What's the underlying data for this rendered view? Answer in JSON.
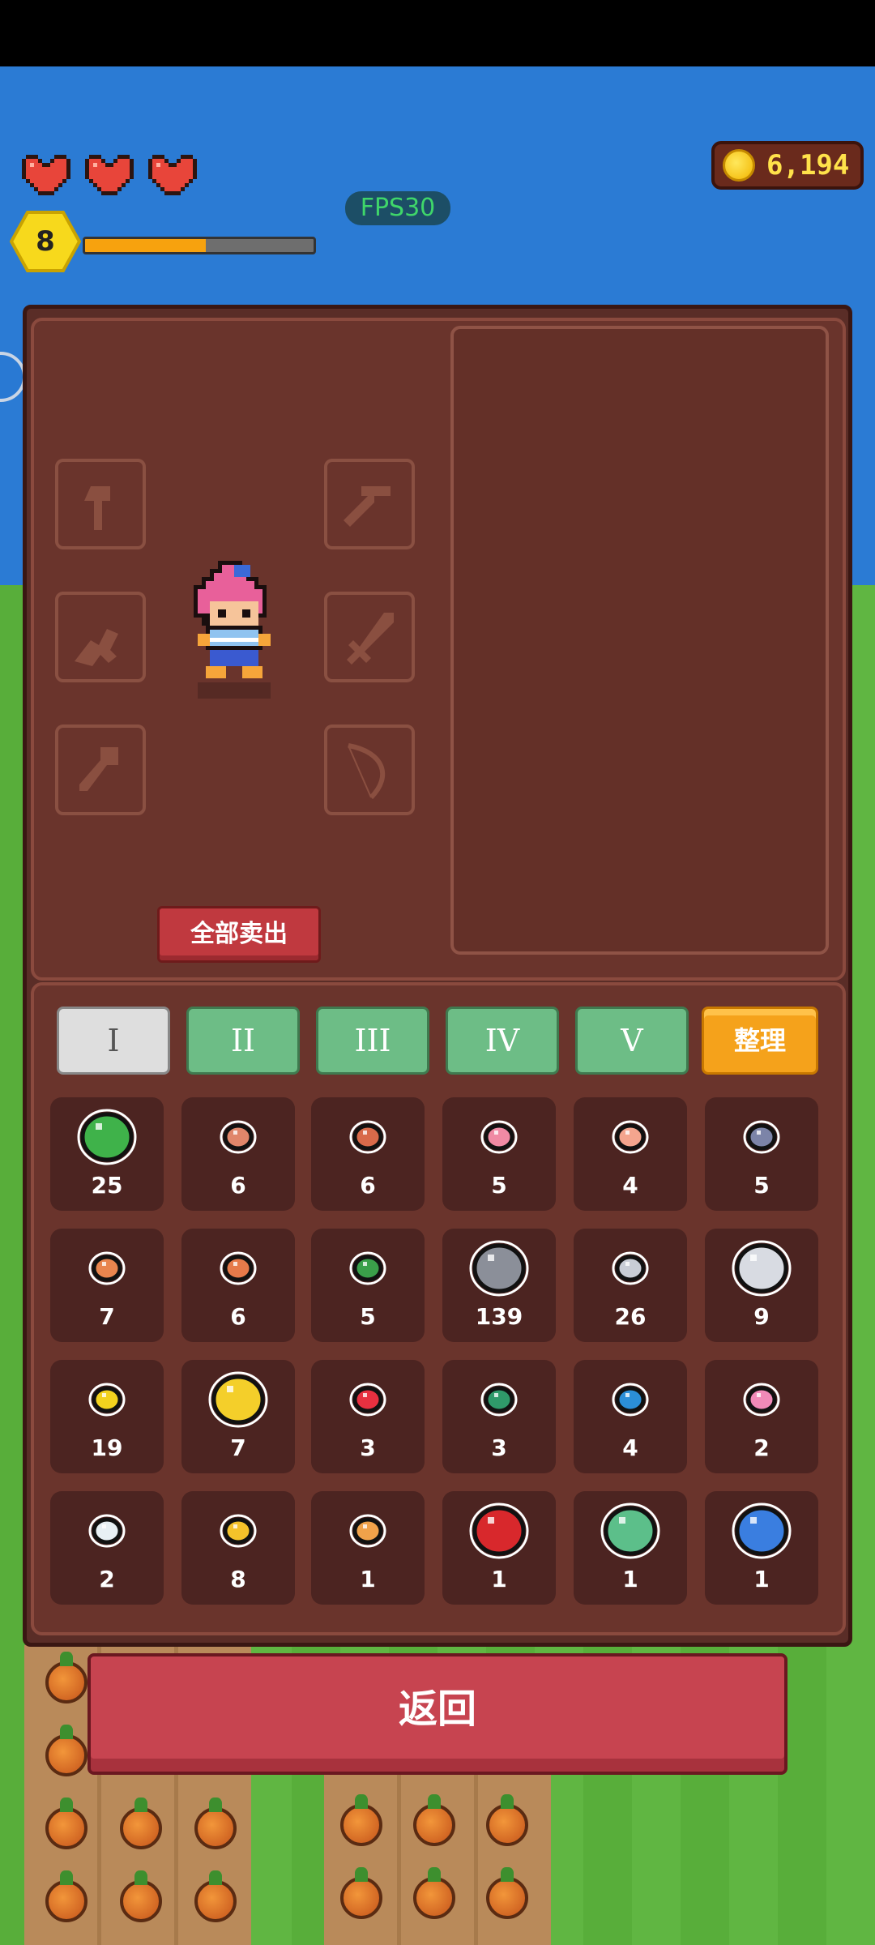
{
  "hud": {
    "hearts": 3,
    "coins": "6,194",
    "fps": "FPS30",
    "level": "8",
    "xp_progress": 0.53
  },
  "equipment": {
    "left_slots": [
      "axe-icon",
      "slingshot-icon",
      "shovel-icon"
    ],
    "right_slots": [
      "pickaxe-icon",
      "sword-icon",
      "bow-icon"
    ],
    "sell_all_label": "全部卖出"
  },
  "tabs": [
    {
      "label": "I",
      "active": true
    },
    {
      "label": "II",
      "active": false
    },
    {
      "label": "III",
      "active": false
    },
    {
      "label": "IV",
      "active": false
    },
    {
      "label": "V",
      "active": false
    }
  ],
  "sort_label": "整理",
  "inventory": [
    {
      "icon": "green-slime-icon",
      "color": "#3fb24a",
      "count": "25"
    },
    {
      "icon": "copper-ore-icon",
      "color": "#e0866a",
      "count": "6"
    },
    {
      "icon": "copper-gem-icon",
      "color": "#d86a4a",
      "count": "6"
    },
    {
      "icon": "pink-gem-icon",
      "color": "#f08aa4",
      "count": "5"
    },
    {
      "icon": "peach-gem-icon",
      "color": "#f4a58e",
      "count": "4"
    },
    {
      "icon": "slate-gem-icon",
      "color": "#7c84a8",
      "count": "5"
    },
    {
      "icon": "orange-gem-icon",
      "color": "#e8854e",
      "count": "7"
    },
    {
      "icon": "amber-gem-icon",
      "color": "#e67a4a",
      "count": "6"
    },
    {
      "icon": "green-leaf-gem-icon",
      "color": "#3aa04a",
      "count": "5"
    },
    {
      "icon": "iron-ore-icon",
      "color": "#8b8f99",
      "count": "139"
    },
    {
      "icon": "silver-nugget-icon",
      "color": "#c9cdd6",
      "count": "26"
    },
    {
      "icon": "silver-bar-icon",
      "color": "#d8dbe2",
      "count": "9"
    },
    {
      "icon": "gold-nugget-icon",
      "color": "#f2d21e",
      "count": "19"
    },
    {
      "icon": "gold-bar-icon",
      "color": "#f4cf2a",
      "count": "7"
    },
    {
      "icon": "ruby-small-icon",
      "color": "#e83040",
      "count": "3"
    },
    {
      "icon": "emerald-small-icon",
      "color": "#2f9a6a",
      "count": "3"
    },
    {
      "icon": "sapphire-small-icon",
      "color": "#2b8fd8",
      "count": "4"
    },
    {
      "icon": "pink-crystal-icon",
      "color": "#f08ab8",
      "count": "2"
    },
    {
      "icon": "diamond-icon",
      "color": "#e8f0f4",
      "count": "2"
    },
    {
      "icon": "topaz-icon",
      "color": "#f4c22a",
      "count": "8"
    },
    {
      "icon": "amber-crystal-icon",
      "color": "#f0a24a",
      "count": "1"
    },
    {
      "icon": "ruby-large-icon",
      "color": "#d8282c",
      "count": "1"
    },
    {
      "icon": "emerald-large-icon",
      "color": "#5cbf8a",
      "count": "1"
    },
    {
      "icon": "sapphire-large-icon",
      "color": "#3a7ee0",
      "count": "1"
    }
  ],
  "back_label": "返回"
}
